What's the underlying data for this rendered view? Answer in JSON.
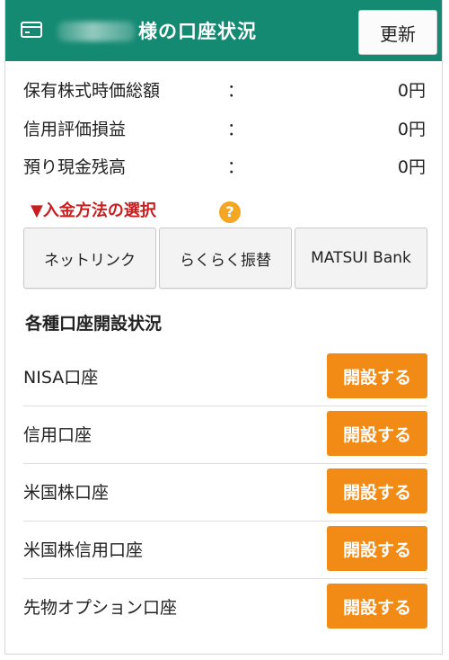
{
  "header": {
    "title": "様の口座状況",
    "refresh_label": "更新",
    "card_icon": "credit-card-icon"
  },
  "summary": [
    {
      "label": "保有株式時価総額",
      "colon": "：",
      "value": "0円"
    },
    {
      "label": "信用評価損益",
      "colon": "：",
      "value": "0円"
    },
    {
      "label": "預り現金残高",
      "colon": "：",
      "value": "0円"
    }
  ],
  "deposit": {
    "label": "▼入金方法の選択",
    "help_icon": "?",
    "methods": [
      "ネットリンク",
      "らくらく振替",
      "MATSUI Bank"
    ]
  },
  "accounts": {
    "title": "各種口座開設状況",
    "items": [
      {
        "label": "NISA口座",
        "button": "開設する"
      },
      {
        "label": "信用口座",
        "button": "開設する"
      },
      {
        "label": "米国株口座",
        "button": "開設する"
      },
      {
        "label": "米国株信用口座",
        "button": "開設する"
      },
      {
        "label": "先物オプション口座",
        "button": "開設する"
      }
    ]
  },
  "colors": {
    "header_bg": "#158a73",
    "deposit_text": "#c81e1e",
    "help_icon": "#f5a623",
    "open_button": "#f28a16"
  }
}
